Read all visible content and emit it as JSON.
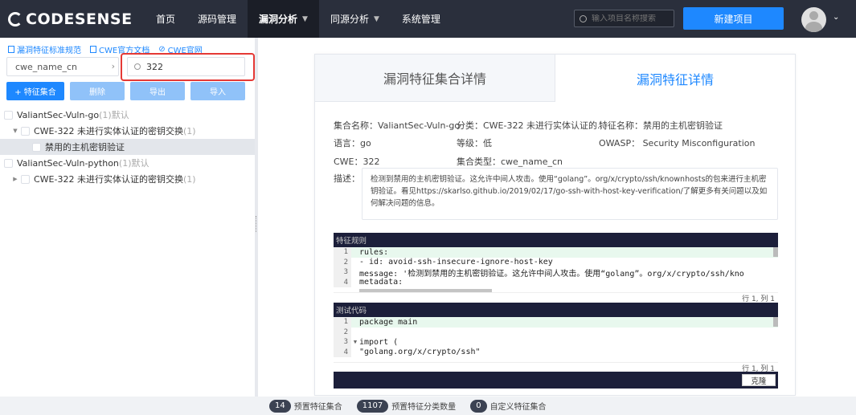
{
  "app": {
    "logo_text": "CODESENSE"
  },
  "nav": {
    "items": [
      {
        "label": "首页"
      },
      {
        "label": "源码管理"
      },
      {
        "label": "漏洞分析"
      },
      {
        "label": "同源分析"
      },
      {
        "label": "系统管理"
      }
    ],
    "active_index": 2,
    "search_placeholder": "输入项目名称搜索",
    "new_project_label": "新建项目"
  },
  "left": {
    "links": [
      "漏洞特征标准规范",
      "CWE官方文档",
      "CWE官网"
    ],
    "filter_select": "cwe_name_cn",
    "filter_value": "322",
    "buttons": {
      "add": "+ 特征集合",
      "delete": "删除",
      "export": "导出",
      "import": "导入"
    },
    "tree": [
      {
        "label": "ValiantSec-Vuln-go",
        "count": "(1)",
        "suffix": "默认",
        "level": 0,
        "expanded": true
      },
      {
        "label": "CWE-322 未进行实体认证的密钥交换",
        "count": "(1)",
        "level": 1,
        "expanded": true
      },
      {
        "label": "禁用的主机密钥验证",
        "level": 2,
        "selected": true
      },
      {
        "label": "ValiantSec-Vuln-python",
        "count": "(1)",
        "suffix": "默认",
        "level": 0,
        "expanded": true
      },
      {
        "label": "CWE-322 未进行实体认证的密钥交换",
        "count": "(1)",
        "level": 1,
        "expanded": false
      }
    ]
  },
  "detail": {
    "tab_collection": "漏洞特征集合详情",
    "tab_feature": "漏洞特征详情",
    "collection_name": "集合名称：ValiantSec-Vuln-go",
    "category": "分类：CWE-322 未进行实体认证的...",
    "feature_name": "特征名称：禁用的主机密钥验证",
    "language": "语言：go",
    "level": "等级：低",
    "owasp": "OWASP： Security Misconfiguration",
    "cwe": "CWE：322",
    "collection_type": "集合类型：cwe_name_cn",
    "desc_label": "描述：",
    "description": "检测到禁用的主机密钥验证。这允许中间人攻击。使用“golang”。org/x/crypto/ssh/knownhosts的包来进行主机密钥验证。看见https://skarlso.github.io/2019/02/17/go-ssh-with-host-key-verification/了解更多有关问题以及如何解决问题的信息。"
  },
  "rules": {
    "title": "特征规则",
    "lines": [
      "rules:",
      "- id: avoid-ssh-insecure-ignore-host-key",
      "  message: '检测到禁用的主机密钥验证。这允许中间人攻击。使用“golang”。org/x/crypto/ssh/kno",
      "  metadata:"
    ],
    "status": "行 1, 列 1"
  },
  "test_code": {
    "title": "测试代码",
    "lines": [
      "package main",
      "",
      "import (",
      "    \"golang.org/x/crypto/ssh\""
    ],
    "status": "行 1, 列 1",
    "clone_label": "克隆"
  },
  "stats": [
    {
      "value": "14",
      "label": "预置特征集合"
    },
    {
      "value": "1107",
      "label": "预置特征分类数量"
    },
    {
      "value": "0",
      "label": "自定义特征集合"
    }
  ]
}
